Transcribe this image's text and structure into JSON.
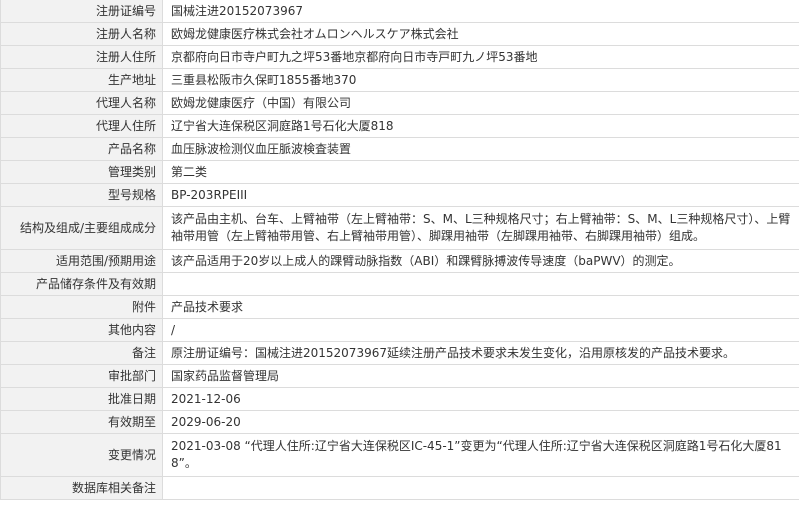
{
  "rows": [
    {
      "label": "注册证编号",
      "value": "国械注进20152073967"
    },
    {
      "label": "注册人名称",
      "value": "欧姆龙健康医疗株式会社オムロンヘルスケア株式会社"
    },
    {
      "label": "注册人住所",
      "value": "京都府向日市寺户町九之坪53番地京都府向日市寺戸町九ノ坪53番地"
    },
    {
      "label": "生产地址",
      "value": "三重县松阪市久保町1855番地370"
    },
    {
      "label": "代理人名称",
      "value": "欧姆龙健康医疗（中国）有限公司"
    },
    {
      "label": "代理人住所",
      "value": "辽宁省大连保税区洞庭路1号石化大厦818"
    },
    {
      "label": "产品名称",
      "value": "血压脉波检测仪血圧脈波検査装置"
    },
    {
      "label": "管理类别",
      "value": "第二类"
    },
    {
      "label": "型号规格",
      "value": "BP-203RPEIII"
    },
    {
      "label": "结构及组成/主要组成成分",
      "value": "该产品由主机、台车、上臂袖带（左上臂袖带：S、M、L三种规格尺寸；右上臂袖带：S、M、L三种规格尺寸）、上臂袖带用管（左上臂袖带用管、右上臂袖带用管）、脚踝用袖带（左脚踝用袖带、右脚踝用袖带）组成。"
    },
    {
      "label": "适用范围/预期用途",
      "value": "该产品适用于20岁以上成人的踝臂动脉指数（ABI）和踝臂脉搏波传导速度（baPWV）的测定。"
    },
    {
      "label": "产品储存条件及有效期",
      "value": ""
    },
    {
      "label": "附件",
      "value": "产品技术要求"
    },
    {
      "label": "其他内容",
      "value": "/"
    },
    {
      "label": "备注",
      "value": "原注册证编号：国械注进20152073967延续注册产品技术要求未发生变化，沿用原核发的产品技术要求。"
    },
    {
      "label": "审批部门",
      "value": "国家药品监督管理局"
    },
    {
      "label": "批准日期",
      "value": "2021-12-06"
    },
    {
      "label": "有效期至",
      "value": "2029-06-20"
    },
    {
      "label": "变更情况",
      "value": "2021-03-08 “代理人住所:辽宁省大连保税区IC-45-1”变更为“代理人住所:辽宁省大连保税区洞庭路1号石化大厦818”。"
    },
    {
      "label": "数据库相关备注",
      "value": ""
    }
  ]
}
